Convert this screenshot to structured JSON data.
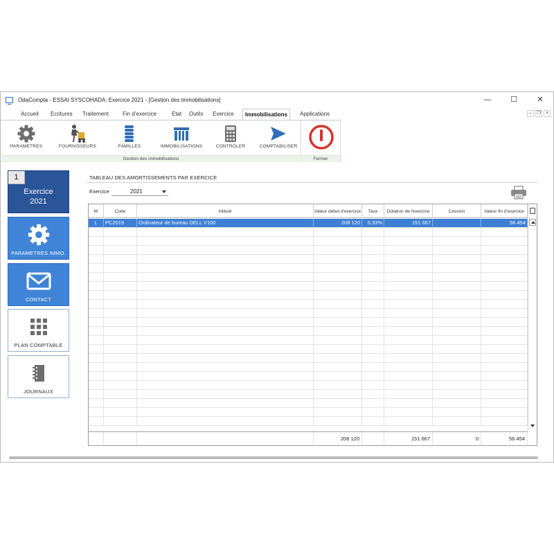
{
  "window": {
    "title": "OdaCompta  - ESSAI SYSCOHADA: Exercice 2021 - [Gestion des immobilisations]",
    "controls": [
      "—",
      "☐",
      "✕"
    ],
    "mdi_controls": [
      "–",
      "❐",
      "×"
    ]
  },
  "menu": [
    "Accueil",
    "Ecritures",
    "Traitement",
    "Fin d'exercice",
    "Etat",
    "Outils",
    "Exercice",
    "Immobilisations",
    "Applications"
  ],
  "ribbon": {
    "buttons": [
      {
        "label": "PARAMETRES",
        "icon": "gear-icon"
      },
      {
        "label": "FOURNISSEURS",
        "icon": "supplier-icon"
      },
      {
        "label": "FAMILLES",
        "icon": "coins-stack-icon"
      },
      {
        "label": "IMMOBILISATIONS",
        "icon": "building-icon"
      },
      {
        "label": "CONTROLER",
        "icon": "calculator-icon"
      },
      {
        "label": "COMPTABILISER",
        "icon": "send-arrow-icon"
      }
    ],
    "group_label": "Gestion des immobilisations",
    "close_label": "Fermer",
    "close_icon": "power-icon"
  },
  "sidebar": {
    "exercise_number": "1",
    "exercise_title": "Exercice",
    "exercise_year": "2021",
    "tiles": [
      {
        "label": "PARAMETRES IMMO.",
        "icon": "gear-icon"
      },
      {
        "label": "CONTACT",
        "icon": "envelope-icon"
      },
      {
        "label": "PLAN COMPTABLE",
        "icon": "grid-icon"
      },
      {
        "label": "JOURNAUX",
        "icon": "notebook-icon"
      }
    ]
  },
  "panel": {
    "title": "TABLEAU DES AMORTISSEMENTS PAR EXERCICE",
    "exercice_label": "Exercice",
    "exercice_value": "2021"
  },
  "table": {
    "headers": {
      "m": "M",
      "code": "Code",
      "intitule": "Intitulé",
      "valeur_debut": "Valeur début d'exercice",
      "taux": "Taux",
      "dotation": "Dotation de l'exercice",
      "cession": "Cession",
      "valeur_fin": "Valeur fin d'exercice"
    },
    "rows": [
      {
        "m": "L",
        "code": "PC2019",
        "intitule": "Ordinateur de bureau DELL V100",
        "valeur_debut": "208 120",
        "taux": "0,33%",
        "dotation": "151 667",
        "cession": "",
        "valeur_fin": "56 454"
      }
    ],
    "totals": {
      "valeur_debut": "208 120",
      "dotation": "151 667",
      "cession": "0",
      "valeur_fin": "56 454"
    }
  },
  "colors": {
    "accent": "#3f84d6",
    "exercise_tile": "#2a5599",
    "selected_row": "#3c7fd4",
    "power_red": "#d9302a",
    "ribbon_icon": "#2f6fb5"
  }
}
